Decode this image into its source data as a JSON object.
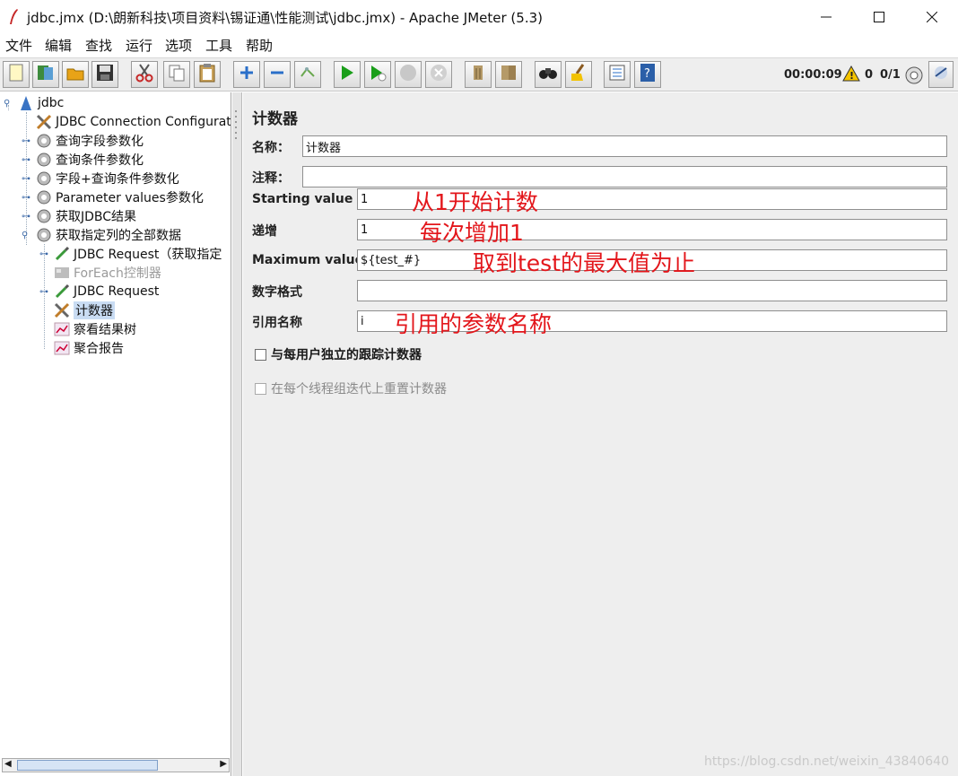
{
  "window": {
    "title": "jdbc.jmx (D:\\朗新科技\\项目资料\\锡证通\\性能测试\\jdbc.jmx) - Apache JMeter (5.3)"
  },
  "menu": [
    "文件",
    "编辑",
    "查找",
    "运行",
    "选项",
    "工具",
    "帮助"
  ],
  "toolbar": {
    "elapsed": "00:00:09",
    "warnings": "0",
    "threads": "0/1",
    "icons": [
      "new-icon",
      "templates-icon",
      "open-icon",
      "save-icon",
      "cut-icon",
      "copy-icon",
      "paste-icon",
      "expand-icon",
      "collapse-icon",
      "toggle-icon",
      "start-icon",
      "start-no-pause-icon",
      "stop-icon",
      "shutdown-icon",
      "clear-icon",
      "clear-all-icon",
      "search-icon",
      "reset-search-icon",
      "function-helper-icon",
      "help-icon"
    ]
  },
  "tree": [
    {
      "label": "jdbc",
      "icon": "test-plan-icon"
    },
    {
      "label": "JDBC Connection Configuratio",
      "icon": "config-tools-icon"
    },
    {
      "label": "查询字段参数化",
      "icon": "thread-group-gear-icon"
    },
    {
      "label": "查询条件参数化",
      "icon": "thread-group-gear-icon"
    },
    {
      "label": "字段+查询条件参数化",
      "icon": "thread-group-gear-icon"
    },
    {
      "label": "Parameter values参数化",
      "icon": "thread-group-gear-icon"
    },
    {
      "label": "获取JDBC结果",
      "icon": "thread-group-gear-icon"
    },
    {
      "label": "获取指定列的全部数据",
      "icon": "thread-group-gear-icon"
    },
    {
      "label": "JDBC Request（获取指定",
      "icon": "sampler-pipette-icon"
    },
    {
      "label": "ForEach控制器",
      "icon": "controller-icon"
    },
    {
      "label": "JDBC Request",
      "icon": "sampler-pipette-icon"
    },
    {
      "label": "计数器",
      "icon": "config-tools-icon"
    },
    {
      "label": "察看结果树",
      "icon": "listener-graph-icon"
    },
    {
      "label": "聚合报告",
      "icon": "listener-graph-icon"
    }
  ],
  "panel": {
    "title": "计数器",
    "name_label": "名称：",
    "name_value": "计数器",
    "comment_label": "注释：",
    "comment_value": "",
    "start_label": "Starting value",
    "start_value": "1",
    "increment_label": "递增",
    "increment_value": "1",
    "max_label": "Maximum value",
    "max_value": "${test_#}",
    "format_label": "数字格式",
    "format_value": "",
    "ref_label": "引用名称",
    "ref_value": "i",
    "per_user_label": "与每用户独立的跟踪计数器",
    "reset_label": "在每个线程组迭代上重置计数器"
  },
  "annotations": {
    "start": "从1开始计数",
    "increment": "每次增加1",
    "max": "取到test的最大值为止",
    "ref": "引用的参数名称"
  },
  "watermark": "https://blog.csdn.net/weixin_43840640",
  "colors": {
    "annotation": "#e3161b",
    "selection": "#c9dcf3",
    "panel_bg": "#eeeeee"
  }
}
